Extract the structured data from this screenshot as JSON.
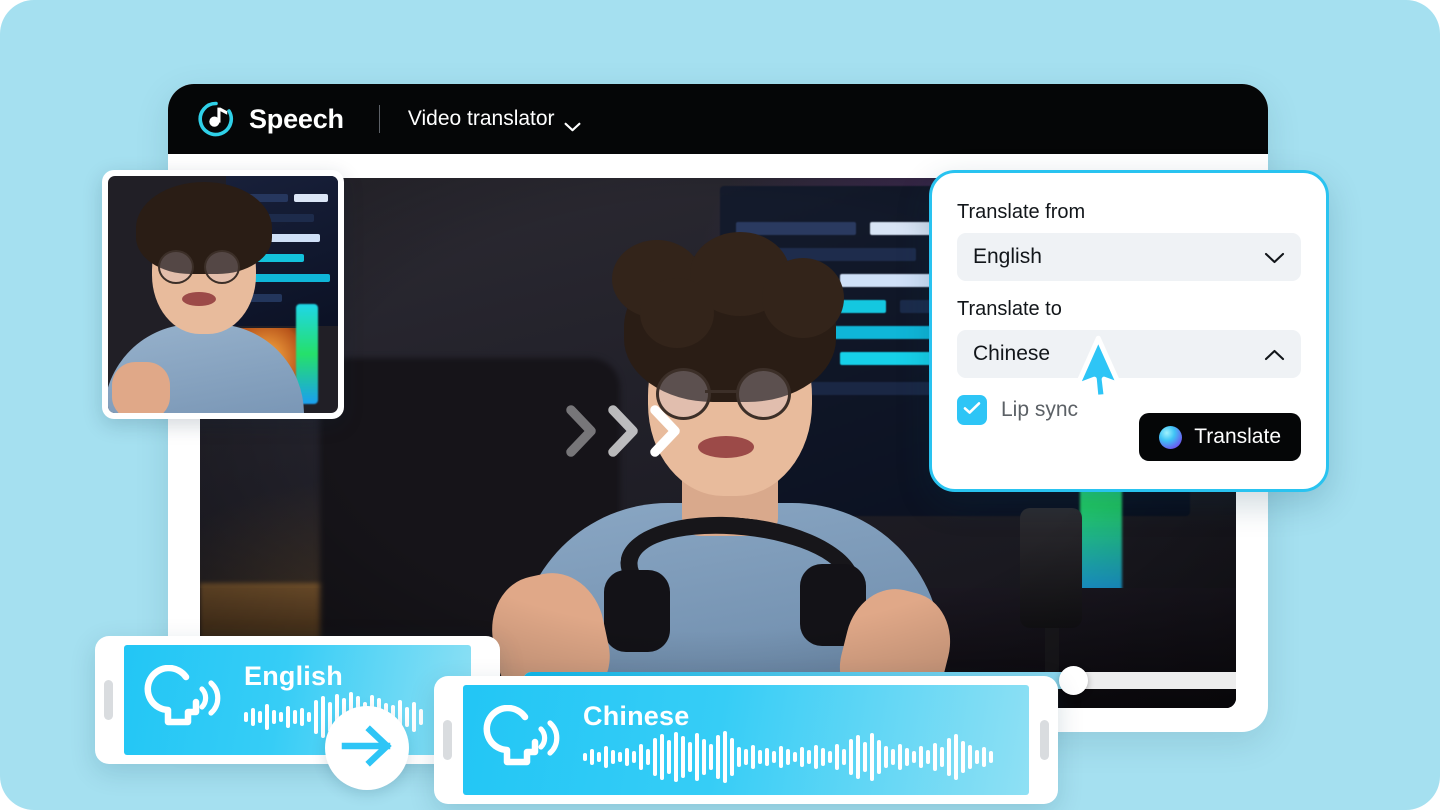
{
  "theme": {
    "background": "#a5e0f0",
    "accent_cyan": "#29c3f0",
    "card_gradient_start": "#22c6f5",
    "card_gradient_end": "#8fe0f4",
    "header_black": "#050607",
    "field_gray": "#eff2f5"
  },
  "header": {
    "logo_icon": "speech-music-note-logo",
    "brand": "Speech",
    "menu_label": "Video translator",
    "menu_caret_icon": "chevron-down-icon"
  },
  "video": {
    "thumbnail_alt": "speaker-thumbnail",
    "chevron_icon": "chevron-right-icon",
    "chevron_count": 3,
    "play_icon": "play-icon",
    "progress_percent": 72
  },
  "panel": {
    "from_label": "Translate from",
    "from_value": "English",
    "from_caret_icon": "chevron-down-icon",
    "to_label": "Translate to",
    "to_value": "Chinese",
    "to_caret_icon": "chevron-up-icon",
    "lipsync_label": "Lip sync",
    "lipsync_checked": true,
    "check_icon": "checkmark-icon",
    "translate_label": "Translate",
    "translate_orb_icon": "gradient-orb-icon"
  },
  "cursor": {
    "icon": "mouse-pointer-icon"
  },
  "audio_cards": [
    {
      "id": "english",
      "language": "English",
      "speak_icon": "speaking-head-icon",
      "waveform": [
        10,
        18,
        12,
        26,
        14,
        10,
        22,
        14,
        18,
        10,
        34,
        42,
        30,
        46,
        38,
        50,
        42,
        30,
        44,
        38,
        28,
        24,
        34,
        20,
        30,
        16
      ]
    },
    {
      "id": "chinese",
      "language": "Chinese",
      "speak_icon": "speaking-head-icon",
      "waveform": [
        8,
        16,
        10,
        22,
        14,
        10,
        18,
        12,
        26,
        16,
        38,
        46,
        34,
        50,
        42,
        30,
        48,
        36,
        26,
        44,
        52,
        38,
        20,
        16,
        24,
        14,
        18,
        12,
        22,
        16,
        10,
        20,
        14,
        24,
        18,
        12,
        26,
        16,
        36,
        44,
        30,
        48,
        34,
        22,
        16,
        26,
        18,
        12,
        22,
        14,
        28,
        20,
        38,
        46,
        32,
        24,
        14,
        20,
        12
      ]
    }
  ],
  "arrow_between_cards": {
    "icon": "arrow-right-icon"
  }
}
